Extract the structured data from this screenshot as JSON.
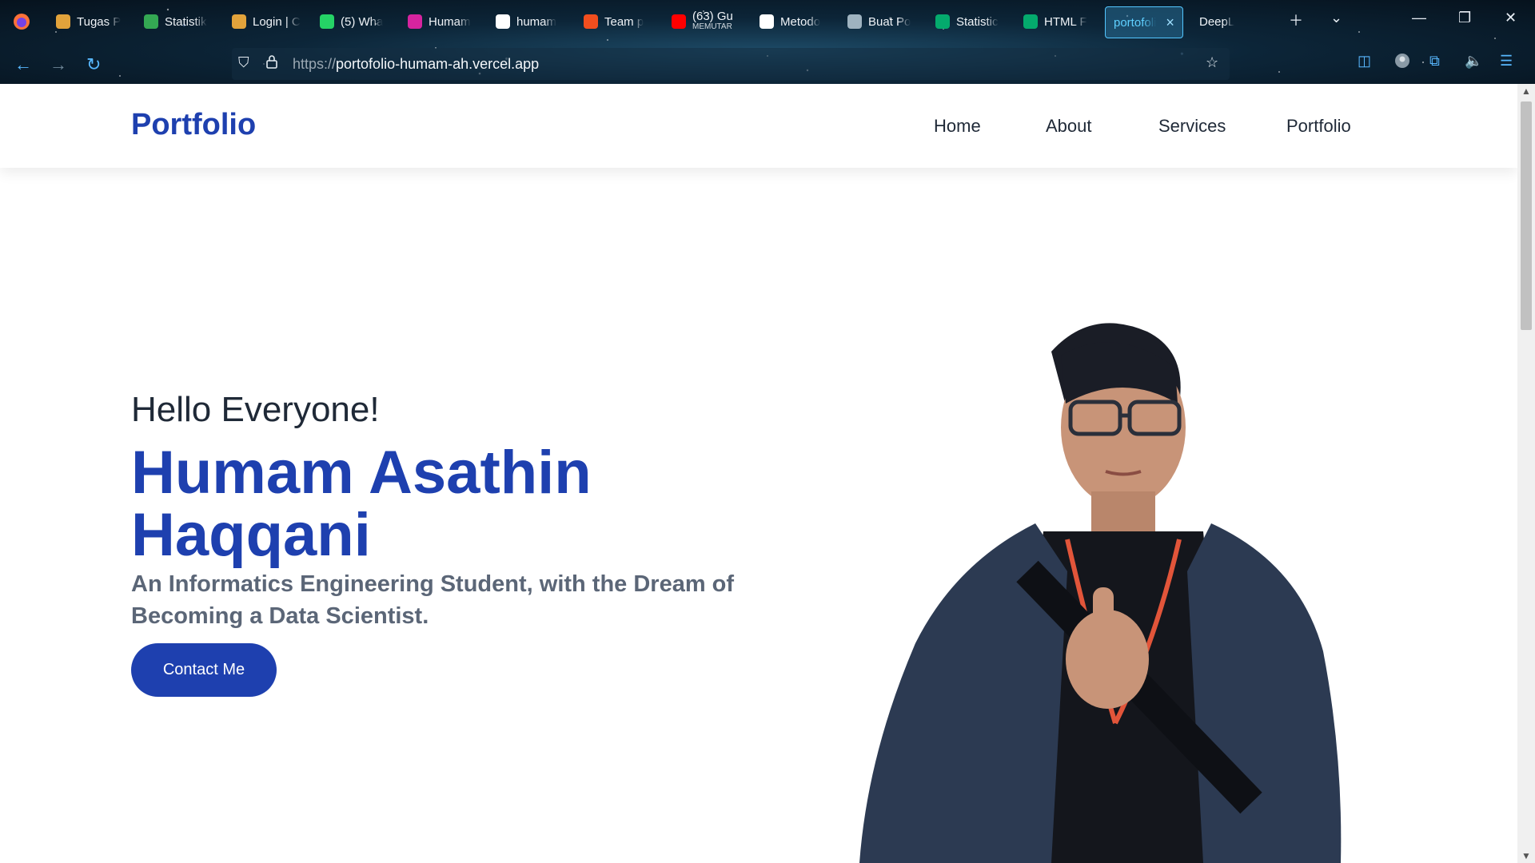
{
  "browser": {
    "tabs": [
      {
        "label": "Tugas P",
        "icon": "hexagon-icon",
        "color": "#e2a33b"
      },
      {
        "label": "Statistik",
        "icon": "google-drive-icon",
        "color": "#34a853"
      },
      {
        "label": "Login | C",
        "icon": "hexagon-icon",
        "color": "#e2a33b"
      },
      {
        "label": "(5) Wha",
        "icon": "whatsapp-icon",
        "color": "#25d366"
      },
      {
        "label": "Humam",
        "icon": "instagram-icon",
        "color": "#d6249f"
      },
      {
        "label": "humam",
        "icon": "github-icon",
        "color": "#ffffff"
      },
      {
        "label": "Team p",
        "icon": "figma-icon",
        "color": "#f24e1e"
      },
      {
        "label": "(63) Gu",
        "sublabel": "MEMUTAR",
        "icon": "youtube-icon",
        "color": "#ff0000"
      },
      {
        "label": "Metodo",
        "icon": "g-icon",
        "color": "#ffffff"
      },
      {
        "label": "Buat Po",
        "icon": "chatgpt-icon",
        "color": "#9fb3c0"
      },
      {
        "label": "Statistic",
        "icon": "w3-icon",
        "color": "#04aa6d"
      },
      {
        "label": "HTML F",
        "icon": "w3-icon",
        "color": "#04aa6d"
      },
      {
        "label": "portofoli",
        "icon": "",
        "color": "#53c6ff"
      },
      {
        "label": "DeepL",
        "icon": "",
        "color": "#ffffff"
      }
    ],
    "url_protocol": "https://",
    "url_host": "portofolio-humam-ah.vercel.app"
  },
  "site": {
    "logo": "Portfolio",
    "nav": [
      "Home",
      "About",
      "Services",
      "Portfolio"
    ],
    "greeting": "Hello Everyone!",
    "name": "Humam Asathin Haqqani",
    "tagline": "An Informatics Engineering Student, with the Dream of Becoming a Data Scientist.",
    "cta": "Contact Me",
    "accent": "#1e40af"
  }
}
